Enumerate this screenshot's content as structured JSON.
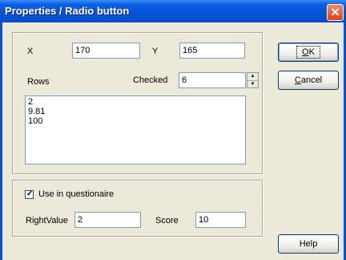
{
  "window": {
    "title": "Properties / Radio button",
    "close_glyph": "✕"
  },
  "position": {
    "x_label": "X",
    "x_value": "170",
    "y_label": "Y",
    "y_value": "165"
  },
  "rows": {
    "label": "Rows",
    "values": [
      "2",
      "9.81",
      "100"
    ]
  },
  "checked": {
    "label": "Checked",
    "value": "6"
  },
  "questionnaire": {
    "use_label": "Use in questionaire",
    "use_checked": true,
    "right_value_label": "RightValue",
    "right_value": "2",
    "score_label": "Score",
    "score_value": "10"
  },
  "buttons": {
    "ok_prefix": "",
    "ok_accel": "O",
    "ok_rest": "K",
    "cancel_accel": "C",
    "cancel_rest": "ancel",
    "help_label": "Help"
  },
  "colors": {
    "title_bar": "#0653d6",
    "dialog_bg": "#ece9d8",
    "close_button": "#d9411e"
  }
}
